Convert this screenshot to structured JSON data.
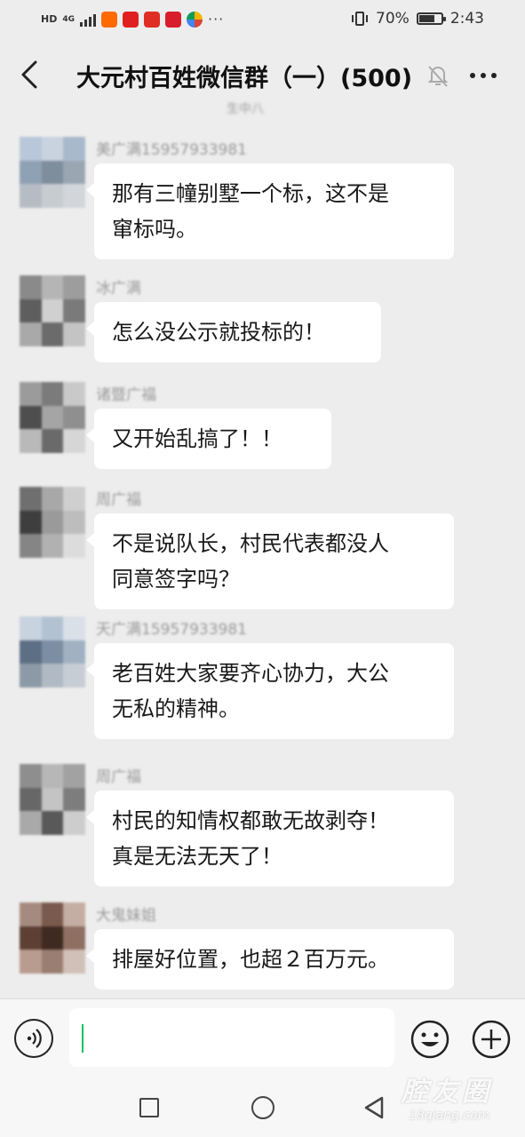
{
  "status_bar": {
    "network_left": "HD",
    "network_type": "4G",
    "dots": "···",
    "battery": "70%",
    "time": "2:43"
  },
  "header": {
    "title": "大元村百姓微信群（一）(500)",
    "peek_text": "生中八"
  },
  "messages": [
    {
      "sender": "美广满15957933981",
      "lines": [
        "那有三幢别墅一个标，这不是",
        "窜标吗。"
      ],
      "avatar_colors": [
        "#b8c7d9",
        "#c9d3df",
        "#a9b9cc",
        "#8fa1b4",
        "#7f8e9d",
        "#9aa7b3",
        "#b5bcc4",
        "#c7ccd1",
        "#d2d6da"
      ]
    },
    {
      "sender": "冰广满",
      "lines": [
        "怎么没公示就投标的！"
      ],
      "avatar_colors": [
        "#8a8a8a",
        "#b5b5b5",
        "#9d9d9d",
        "#5e5e5e",
        "#d0d0d0",
        "#7a7a7a",
        "#a9a9a9",
        "#6b6b6b",
        "#c4c4c4"
      ]
    },
    {
      "sender": "诸暨广福",
      "lines": [
        "又开始乱搞了！！"
      ],
      "avatar_colors": [
        "#9b9b9b",
        "#7b7b7b",
        "#c9c9c9",
        "#4e4e4e",
        "#a5a5a5",
        "#8f8f8f",
        "#b9b9b9",
        "#6a6a6a",
        "#d6d6d6"
      ]
    },
    {
      "sender": "周广福",
      "lines": [
        "不是说队长，村民代表都没人",
        "同意签字吗？"
      ],
      "avatar_colors": [
        "#6f6f6f",
        "#a8a8a8",
        "#cfcfcf",
        "#3e3e3e",
        "#9a9a9a",
        "#bdbdbd",
        "#858585",
        "#b1b1b1",
        "#dcdcdc"
      ]
    },
    {
      "sender": "天广满15957933981",
      "lines": [
        "老百姓大家要齐心协力，大公",
        "无私的精神。"
      ],
      "avatar_colors": [
        "#c8d3e0",
        "#b3c2d2",
        "#d9e0e8",
        "#5c6f84",
        "#7b8ea3",
        "#a1b1c2",
        "#8c99a6",
        "#b0bac4",
        "#c6cdd4"
      ]
    },
    {
      "sender": "周广福",
      "lines": [
        "村民的知情权都敢无故剥夺！",
        "真是无法无天了！"
      ],
      "avatar_colors": [
        "#8e8e8e",
        "#b7b7b7",
        "#a2a2a2",
        "#676767",
        "#c4c4c4",
        "#7d7d7d",
        "#a9a9a9",
        "#595959",
        "#cdcdcd"
      ]
    },
    {
      "sender": "大鬼妹姐",
      "lines": [
        "排屋好位置，也超２百万元。"
      ],
      "avatar_colors": [
        "#a58b7f",
        "#7a5a4c",
        "#c4ada3",
        "#5d3f33",
        "#3f2a22",
        "#8e6f62",
        "#b89c90",
        "#9b7e72",
        "#d1c0b8"
      ]
    }
  ],
  "input": {
    "value": ""
  },
  "watermark": {
    "main": "腔友圈",
    "sub": "18qiang.com"
  },
  "colors": {
    "background": "#ededed",
    "bubble": "#ffffff",
    "accent": "#07c160"
  },
  "icons": [
    "back-arrow-icon",
    "mute-bell-icon",
    "more-icon",
    "voice-icon",
    "emoji-icon",
    "plus-icon",
    "nav-recents-icon",
    "nav-home-icon",
    "nav-back-icon"
  ]
}
